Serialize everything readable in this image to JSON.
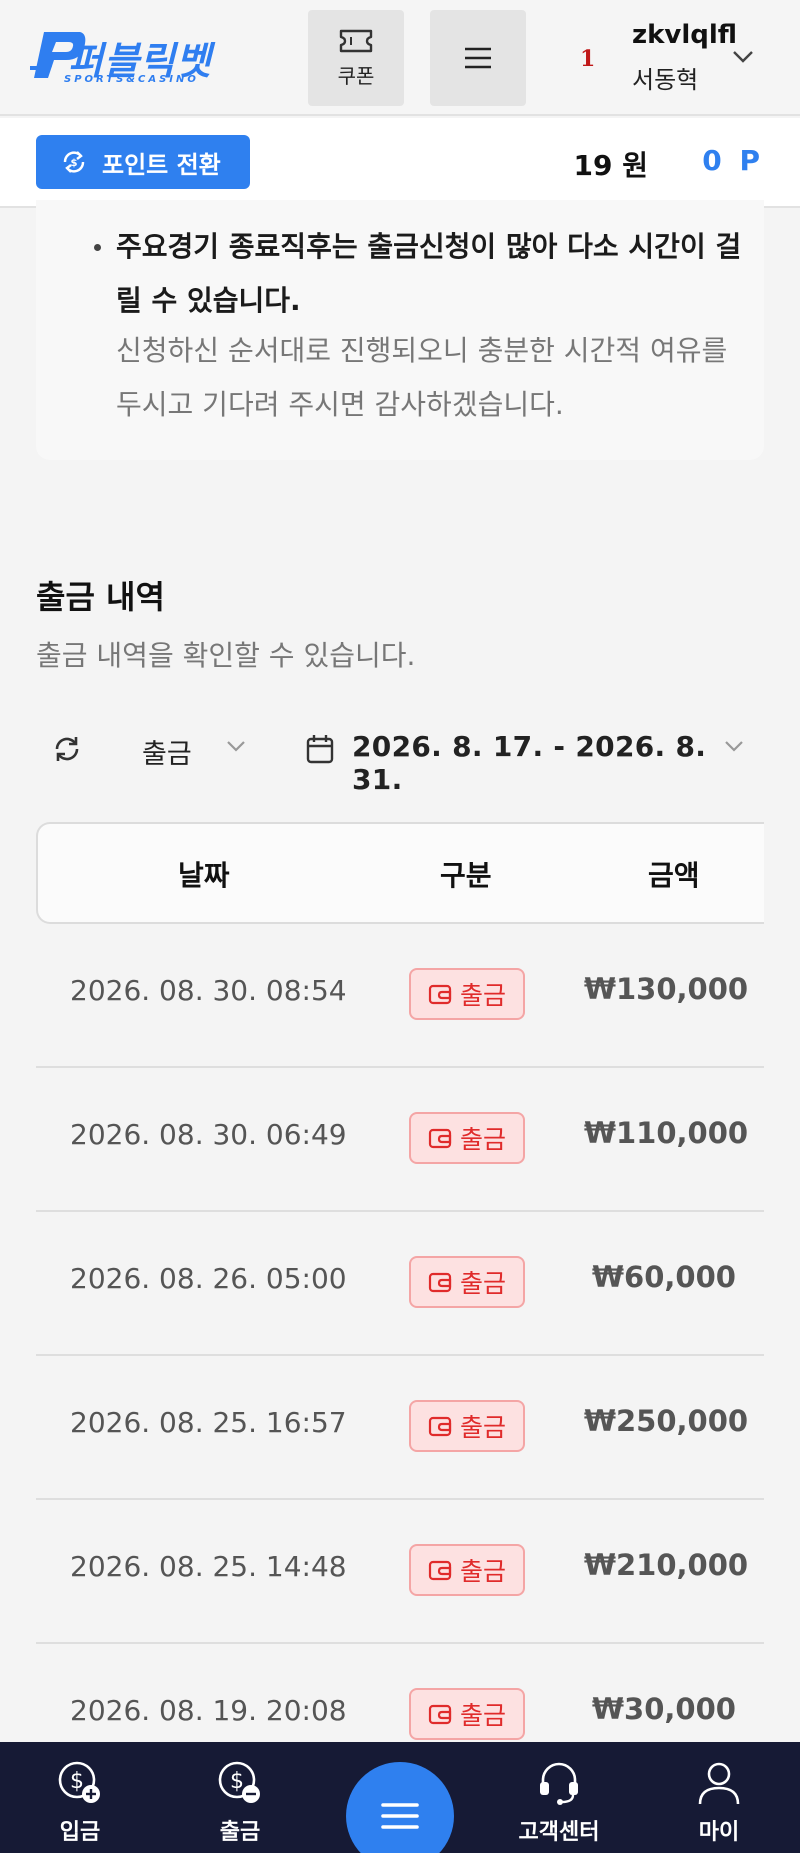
{
  "header": {
    "logo_text": "퍼블릭벳",
    "logo_sub": "SPORTS&CASINO",
    "coupon_label": "쿠폰",
    "level": "1",
    "user_id": "zkvlqlfl",
    "user_name": "서동혁"
  },
  "subbar": {
    "point_button_label": "포인트 전환",
    "balance": "19 원",
    "points": "0 P"
  },
  "notice": {
    "bold_text": "주요경기 종료직후는 출금신청이 많아 다소 시간이 걸릴 수 있습니다.",
    "light_text": "신청하신 순서대로 진행되오니 충분한 시간적 여유를 두시고 기다려 주시면 감사하겠습니다."
  },
  "section": {
    "title": "출금 내역",
    "subtitle": "출금 내역을 확인할 수 있습니다."
  },
  "filters": {
    "type_value": "출금",
    "date_range": "2026. 8. 17. - 2026. 8. 31."
  },
  "table": {
    "headers": [
      "날짜",
      "구분",
      "금액"
    ],
    "rows": [
      {
        "date": "2026. 08. 30. 08:54",
        "type": "출금",
        "amount": "₩130,000"
      },
      {
        "date": "2026. 08. 30. 06:49",
        "type": "출금",
        "amount": "₩110,000"
      },
      {
        "date": "2026. 08. 26. 05:00",
        "type": "출금",
        "amount": "₩60,000"
      },
      {
        "date": "2026. 08. 25. 16:57",
        "type": "출금",
        "amount": "₩250,000"
      },
      {
        "date": "2026. 08. 25. 14:48",
        "type": "출금",
        "amount": "₩210,000"
      },
      {
        "date": "2026. 08. 19. 20:08",
        "type": "출금",
        "amount": "₩30,000"
      }
    ]
  },
  "bottom_nav": {
    "deposit": "입금",
    "withdraw": "출금",
    "support": "고객센터",
    "my": "마이"
  },
  "colors": {
    "accent": "#2f80ef",
    "badge_bg": "#fde1e1",
    "badge_text": "#e02b2b",
    "nav_bg": "#161a35"
  }
}
